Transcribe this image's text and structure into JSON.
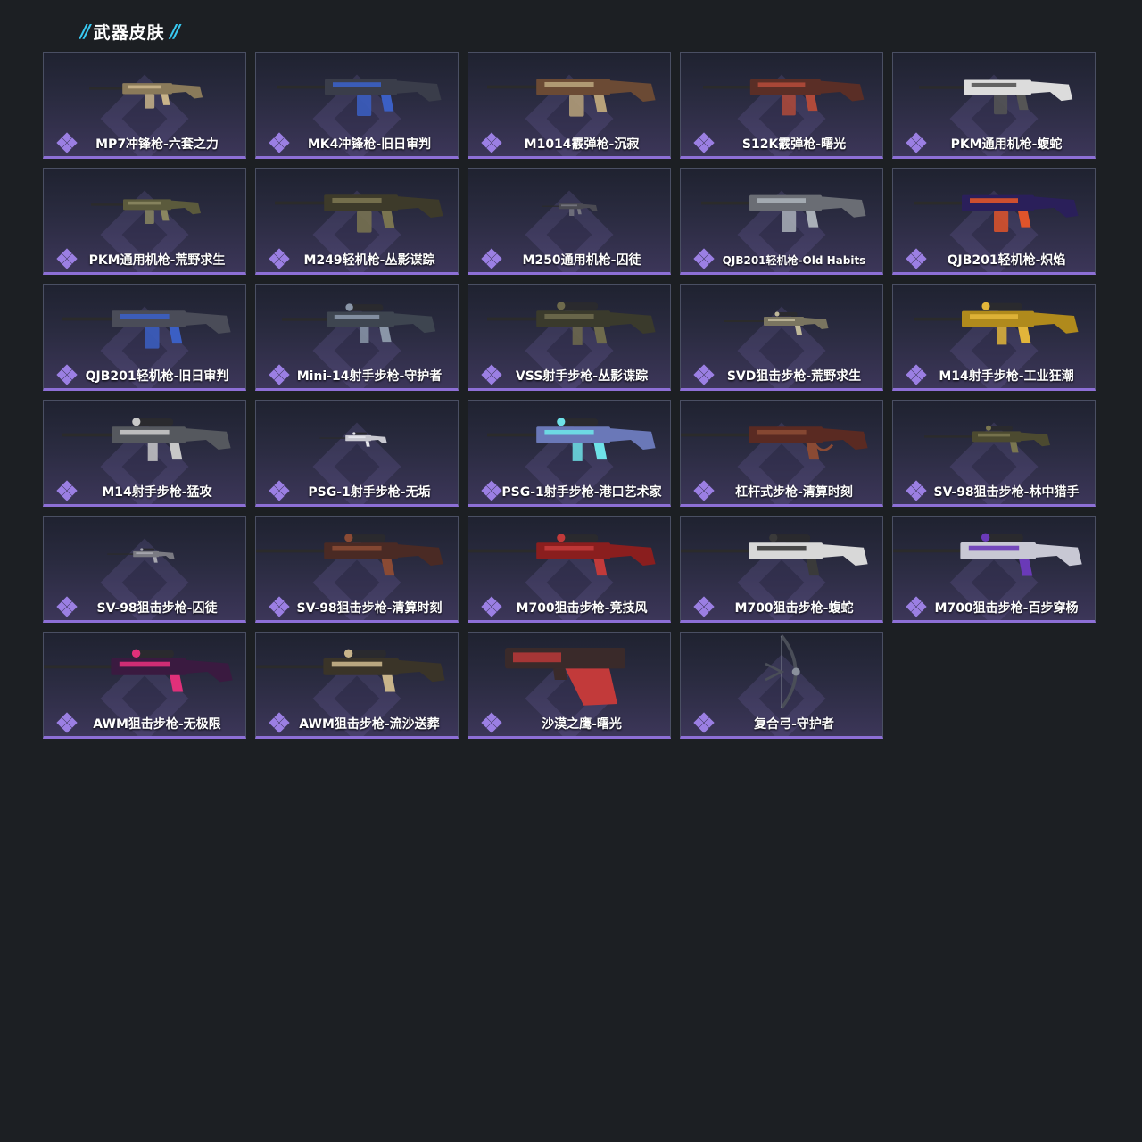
{
  "section": {
    "title": "武器皮肤"
  },
  "colors": {
    "accent_rarity": "#9b7fe3",
    "title_slash": "#38c8f0",
    "background": "#1c1f23"
  },
  "skins": [
    {
      "name": "MP7冲锋枪-六套之力",
      "icon": "smg-icon",
      "tint": "#8a7a5a",
      "accent": "#c9b48a",
      "scale": 0.62
    },
    {
      "name": "MK4冲锋枪-旧日审判",
      "icon": "smg-icon",
      "tint": "#3a3d4a",
      "accent": "#3b5fc4",
      "scale": 0.9
    },
    {
      "name": "M1014霰弹枪-沉寂",
      "icon": "shotgun-icon",
      "tint": "#6b4a34",
      "accent": "#b8a27a",
      "scale": 0.92
    },
    {
      "name": "S12K霰弹枪-曙光",
      "icon": "shotgun-icon",
      "tint": "#5a2e26",
      "accent": "#b04a3a",
      "scale": 0.88
    },
    {
      "name": "PKM通用机枪-蝮蛇",
      "icon": "machinegun-icon",
      "tint": "#dcdcdc",
      "accent": "#555555",
      "scale": 0.84
    },
    {
      "name": "PKM通用机枪-荒野求生",
      "icon": "machinegun-icon",
      "tint": "#5b5a3c",
      "accent": "#8a8660",
      "scale": 0.6
    },
    {
      "name": "M249轻机枪-丛影谍踪",
      "icon": "machinegun-icon",
      "tint": "#3d3a2a",
      "accent": "#7a7450",
      "scale": 0.92
    },
    {
      "name": "M250通用机枪-囚徒",
      "icon": "machinegun-icon",
      "tint": "#4a4a52",
      "accent": "#777780",
      "scale": 0.3
    },
    {
      "name": "QJB201轻机枪-Old Habits",
      "icon": "machinegun-icon",
      "tint": "#6a6d74",
      "accent": "#aab0b8",
      "scale": 0.9
    },
    {
      "name": "QJB201轻机枪-炽焰",
      "icon": "machinegun-icon",
      "tint": "#2a1f5a",
      "accent": "#e0542a",
      "scale": 0.9
    },
    {
      "name": "QJB201轻机枪-旧日审判",
      "icon": "machinegun-icon",
      "tint": "#4a4c58",
      "accent": "#3b5fc4",
      "scale": 0.92
    },
    {
      "name": "Mini-14射手步枪-守护者",
      "icon": "rifle-icon",
      "tint": "#3e4550",
      "accent": "#8a96a8",
      "scale": 0.84
    },
    {
      "name": "VSS射手步枪-丛影谍踪",
      "icon": "rifle-icon",
      "tint": "#3a3a2c",
      "accent": "#6e6a4c",
      "scale": 0.92
    },
    {
      "name": "SVD狙击步枪-荒野求生",
      "icon": "sniper-icon",
      "tint": "#7a7560",
      "accent": "#bfb89a",
      "scale": 0.5
    },
    {
      "name": "M14射手步枪-工业狂潮",
      "icon": "rifle-icon",
      "tint": "#b08a1c",
      "accent": "#e2b53a",
      "scale": 0.9
    },
    {
      "name": "M14射手步枪-猛攻",
      "icon": "rifle-icon",
      "tint": "#55585e",
      "accent": "#c8c8c8",
      "scale": 0.92
    },
    {
      "name": "PSG-1射手步枪-无垢",
      "icon": "sniper-icon",
      "tint": "#c8c8d0",
      "accent": "#e8e8ee",
      "scale": 0.32
    },
    {
      "name": "PSG-1射手步枪-港口艺术家",
      "icon": "rifle-icon",
      "tint": "#6a78b8",
      "accent": "#6ee2e8",
      "scale": 0.92
    },
    {
      "name": "杠杆式步枪-清算时刻",
      "icon": "lever-rifle-icon",
      "tint": "#5a2a22",
      "accent": "#8a4a34",
      "scale": 0.92
    },
    {
      "name": "SV-98狙击步枪-林中猎手",
      "icon": "sniper-icon",
      "tint": "#4c4a30",
      "accent": "#7a7650",
      "scale": 0.6
    },
    {
      "name": "SV-98狙击步枪-囚徒",
      "icon": "sniper-icon",
      "tint": "#7a7a82",
      "accent": "#a8a8b0",
      "scale": 0.32
    },
    {
      "name": "SV-98狙击步枪-清算时刻",
      "icon": "sniper-icon",
      "tint": "#4a2a24",
      "accent": "#8a4a34",
      "scale": 0.92
    },
    {
      "name": "M700狙击步枪-竞技风",
      "icon": "sniper-icon",
      "tint": "#8a1e1e",
      "accent": "#c23a3a",
      "scale": 0.92
    },
    {
      "name": "M700狙击步枪-蝮蛇",
      "icon": "sniper-icon",
      "tint": "#d8d8d8",
      "accent": "#3a3a3a",
      "scale": 0.92
    },
    {
      "name": "M700狙击步枪-百步穿杨",
      "icon": "sniper-icon",
      "tint": "#c8c8d4",
      "accent": "#6a3ab8",
      "scale": 0.94
    },
    {
      "name": "AWM狙击步枪-无极限",
      "icon": "sniper-icon",
      "tint": "#3a1a40",
      "accent": "#e0307a",
      "scale": 0.94
    },
    {
      "name": "AWM狙击步枪-流沙送葬",
      "icon": "sniper-icon",
      "tint": "#3a3428",
      "accent": "#c8b48a",
      "scale": 0.94
    },
    {
      "name": "沙漠之鹰-曙光",
      "icon": "pistol-icon",
      "tint": "#3a2a2a",
      "accent": "#c23a3a",
      "scale": 0.9
    },
    {
      "name": "复合弓-守护者",
      "icon": "bow-icon",
      "tint": "#4a4e58",
      "accent": "#8a909c",
      "scale": 0.9
    }
  ]
}
